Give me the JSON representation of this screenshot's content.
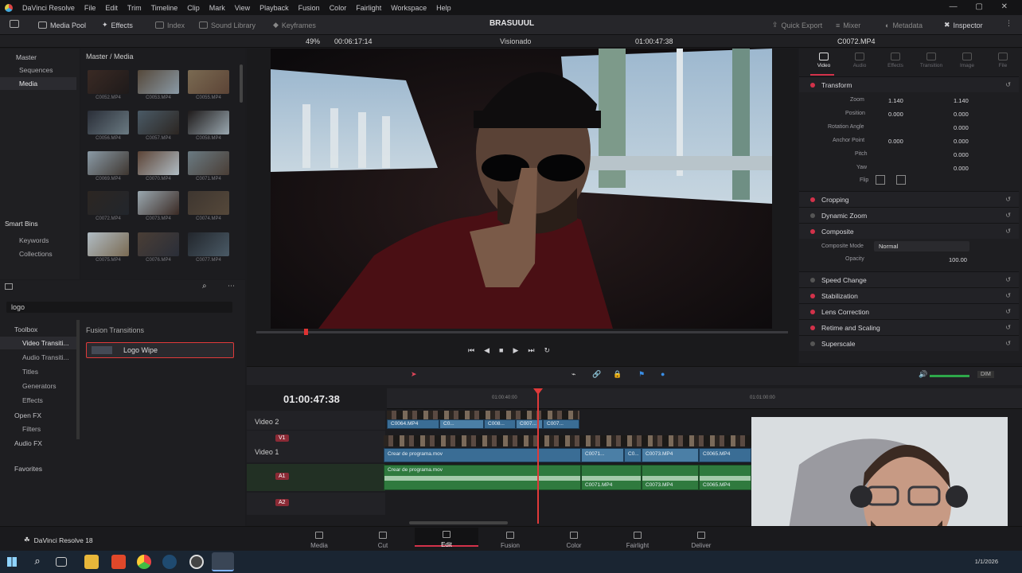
{
  "menu": {
    "app_name": "DaVinci Resolve",
    "items": [
      "File",
      "Edit",
      "Trim",
      "Timeline",
      "Clip",
      "Mark",
      "View",
      "Playback",
      "Fusion",
      "Color",
      "Fairlight",
      "Workspace",
      "Help"
    ]
  },
  "toolbar": {
    "media_pool": "Media Pool",
    "effects": "Effects",
    "index": "Index",
    "sound_library": "Sound Library",
    "keyframes": "Keyframes",
    "project_title": "BRASUUUL",
    "quick_export": "Quick Export",
    "mixer": "Mixer",
    "metadata": "Metadata",
    "inspector": "Inspector"
  },
  "viewer_bar": {
    "zoom": "49%",
    "timecode_left": "00:06:17:14",
    "visionado": "Visionado",
    "timecode_right": "01:00:47:38",
    "clip_name": "C0072.MP4"
  },
  "media_pool": {
    "master": "Master",
    "sub": [
      "Sequences",
      "Media"
    ],
    "header": "Master / Media",
    "clips": [
      "C0052.MP4",
      "C0053.MP4",
      "C0055.MP4",
      "C0056.MP4",
      "C0057.MP4",
      "C0058.MP4",
      "C0069.MP4",
      "C0070.MP4",
      "C0071.MP4",
      "C0072.MP4",
      "C0073.MP4",
      "C0074.MP4",
      "C0075.MP4",
      "C0076.MP4",
      "C0077.MP4"
    ],
    "smart_bins": "Smart Bins",
    "smart_items": [
      "Keywords",
      "Collections"
    ]
  },
  "effects": {
    "search_value": "logo",
    "toolbox": "Toolbox",
    "toolbox_items": [
      "Video Transiti...",
      "Audio Transiti...",
      "Titles",
      "Generators",
      "Effects"
    ],
    "openfx": "Open FX",
    "openfx_items": [
      "Filters"
    ],
    "audiofx": "Audio FX",
    "favorites": "Favorites",
    "list_header": "Fusion Transitions",
    "result": "Logo Wipe"
  },
  "inspector": {
    "tabs": [
      "Video",
      "Audio",
      "Effects",
      "Transition",
      "Image",
      "File"
    ],
    "sections": [
      "Transform",
      "Cropping",
      "Dynamic Zoom",
      "Composite",
      "Speed Change",
      "Stabilization",
      "Lens Correction",
      "Retime and Scaling",
      "Superscale"
    ],
    "transform": {
      "zoom": {
        "label": "Zoom",
        "x": "1.140",
        "y": "1.140"
      },
      "position": {
        "label": "Position",
        "x": "0.000",
        "y": "0.000"
      },
      "rotation": {
        "label": "Rotation Angle",
        "v": "0.000"
      },
      "anchor": {
        "label": "Anchor Point",
        "x": "0.000",
        "y": "0.000"
      },
      "pitch": {
        "label": "Pitch",
        "v": "0.000"
      },
      "yaw": {
        "label": "Yaw",
        "v": "0.000"
      },
      "flip": "Flip"
    },
    "composite": {
      "mode_label": "Composite Mode",
      "mode_value": "Normal",
      "opacity_label": "Opacity",
      "opacity_value": "100.00"
    }
  },
  "timeline": {
    "timecode": "01:00:47:38",
    "ruler": [
      "01:00:40:00",
      "01:01:00:00"
    ],
    "tracks": {
      "v2": "V2",
      "v1": "V1",
      "video1": "Video 1",
      "video2": "Video 2",
      "a1": "A1",
      "a2": "A2"
    },
    "v2_clips": [
      "C0064.MP4",
      "C0...",
      "C008...",
      "C007...",
      "C007..."
    ],
    "v1_labels": [
      "Crear de programa.mov",
      "C0071...",
      "C0...",
      "C0073.MP4",
      "C0065.MP4"
    ],
    "a1_labels": [
      "Crear de programa.mov",
      "C0071.MP4",
      "C0073.MP4",
      "C0065.MP4"
    ],
    "volume_label": "DIM"
  },
  "pages": [
    "Media",
    "Cut",
    "Edit",
    "Fusion",
    "Color",
    "Fairlight",
    "Deliver"
  ],
  "footer_app": "DaVinci Resolve 18",
  "taskbar": {
    "date": "1/1/2026"
  }
}
